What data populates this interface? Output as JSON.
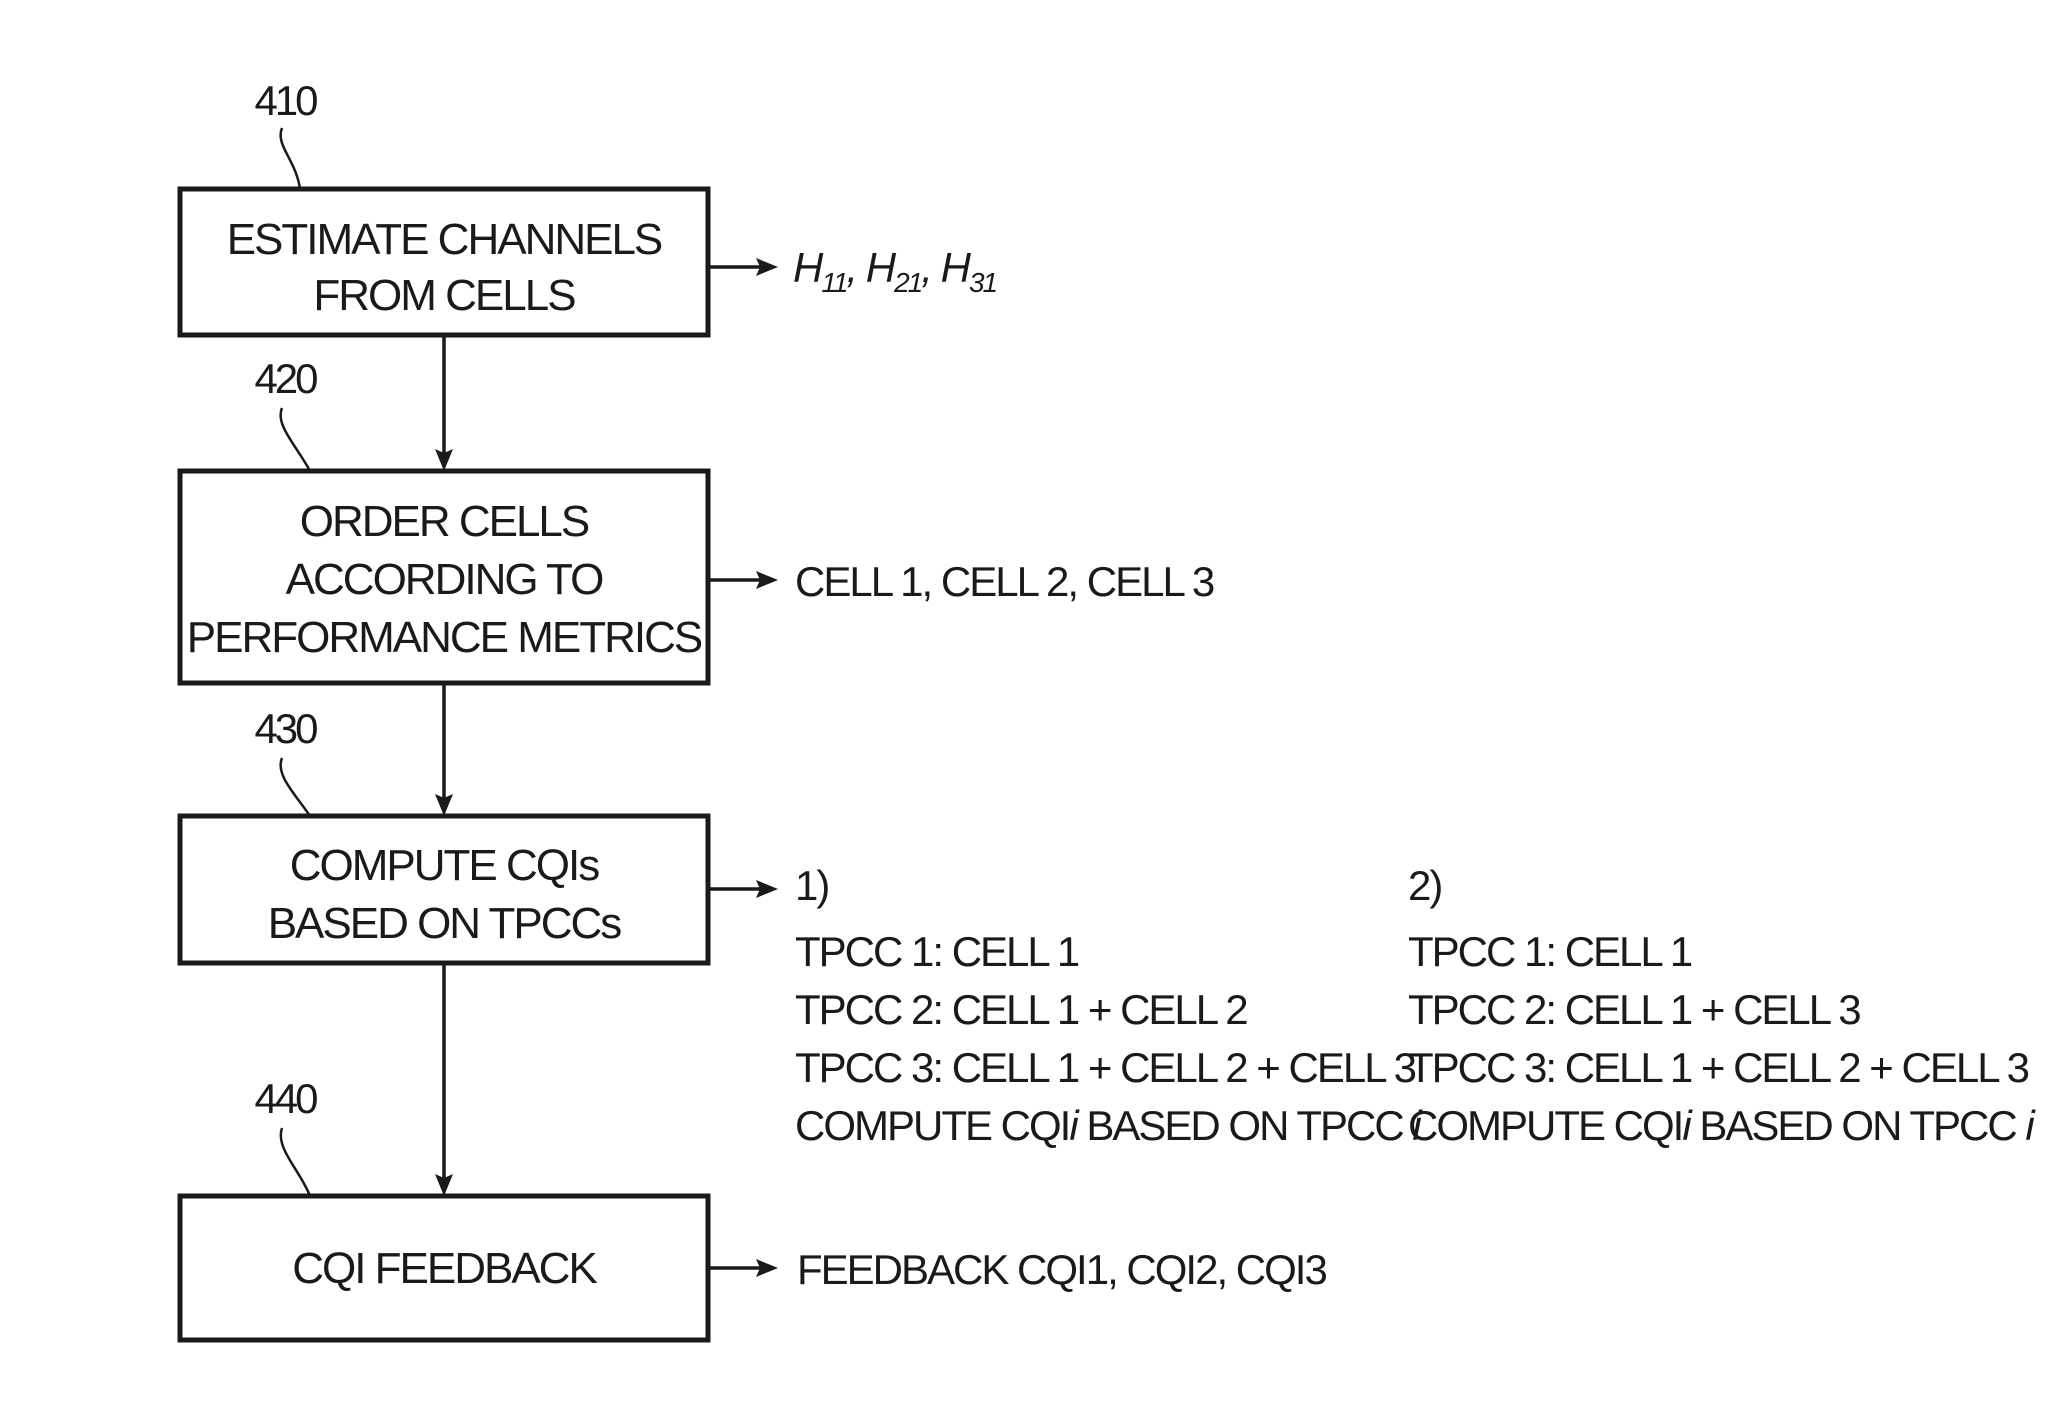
{
  "figure": {
    "type": "flowchart",
    "steps": [
      {
        "ref": "410",
        "lines": [
          "ESTIMATE CHANNELS",
          "FROM CELLS"
        ],
        "output": {
          "parts": [
            {
              "base": "H",
              "sub": "11",
              "sep": ", "
            },
            {
              "base": "H",
              "sub": "21",
              "sep": ", "
            },
            {
              "base": "H",
              "sub": "31",
              "sep": ""
            }
          ]
        }
      },
      {
        "ref": "420",
        "lines": [
          "ORDER CELLS",
          "ACCORDING TO",
          "PERFORMANCE METRICS"
        ],
        "output": {
          "text": "CELL 1, CELL 2, CELL 3"
        }
      },
      {
        "ref": "430",
        "lines": [
          "COMPUTE CQIs",
          "BASED ON TPCCs"
        ],
        "output": {
          "options": [
            {
              "label": "1)",
              "lines": [
                "TPCC 1: CELL 1",
                "TPCC 2: CELL 1 + CELL 2",
                "TPCC 3: CELL 1 + CELL 2 + CELL 3"
              ],
              "last_line": {
                "prefix": "COMPUTE CQI",
                "var1": "i",
                "middle": " BASED ON TPCC ",
                "var2": "i"
              }
            },
            {
              "label": "2)",
              "lines": [
                "TPCC 1: CELL 1",
                "TPCC 2: CELL 1 + CELL 3",
                "TPCC 3: CELL 1 + CELL 2 + CELL 3"
              ],
              "last_line": {
                "prefix": "COMPUTE CQI",
                "var1": "i",
                "middle": " BASED ON TPCC ",
                "var2": "i"
              }
            }
          ]
        }
      },
      {
        "ref": "440",
        "lines": [
          "CQI FEEDBACK"
        ],
        "output": {
          "text": "FEEDBACK CQI1, CQI2, CQI3"
        }
      }
    ]
  }
}
